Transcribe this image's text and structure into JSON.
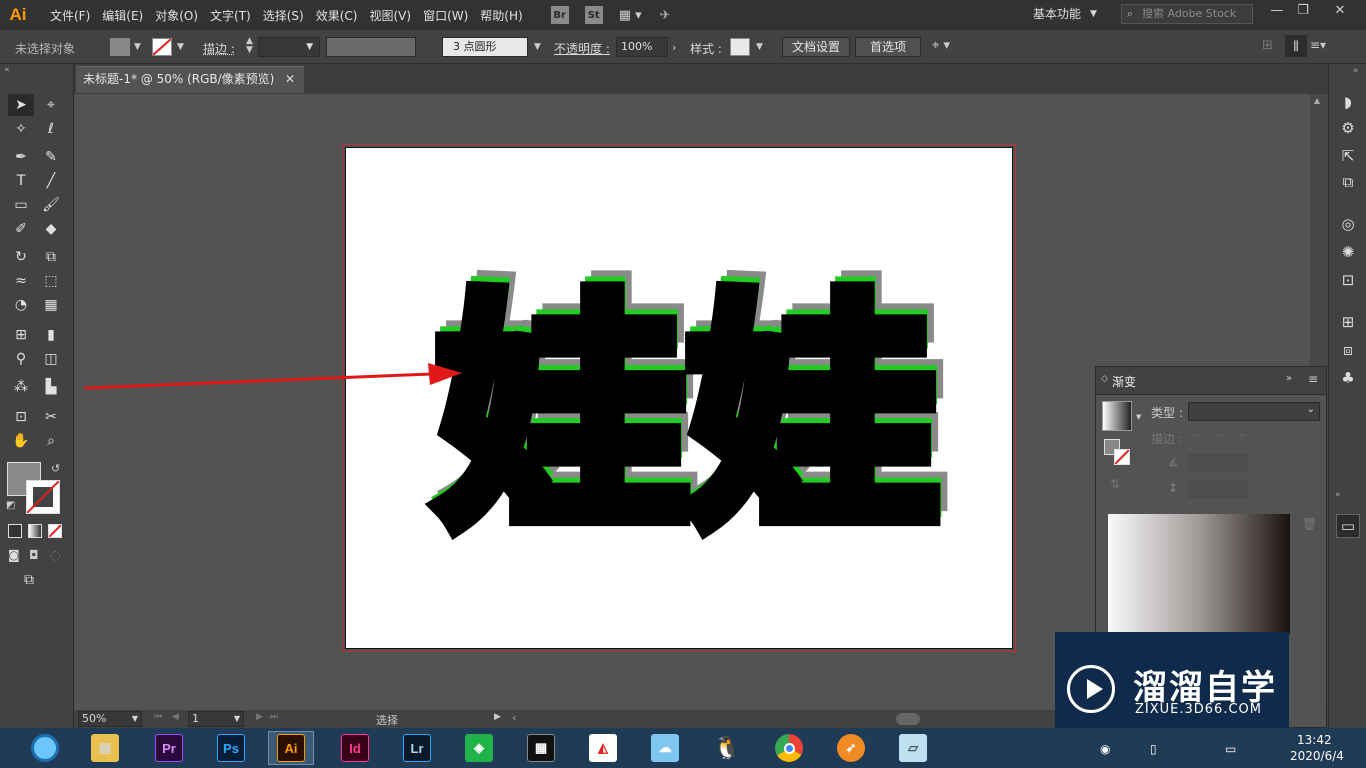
{
  "app": {
    "logo": "Ai"
  },
  "menubar": {
    "items": [
      "文件(F)",
      "编辑(E)",
      "对象(O)",
      "文字(T)",
      "选择(S)",
      "效果(C)",
      "视图(V)",
      "窗口(W)",
      "帮助(H)"
    ],
    "badges": [
      "Br",
      "St"
    ],
    "workspace": "基本功能",
    "search_placeholder": "搜索 Adobe Stock"
  },
  "controlbar": {
    "selection_status": "未选择对象",
    "stroke_label": "描边 :",
    "brush_label": "3 点圆形",
    "opacity_label": "不透明度 :",
    "opacity_value": "100%",
    "style_label": "样式 :",
    "doc_setup_button": "文档设置",
    "preferences_button": "首选项"
  },
  "document": {
    "tab_title": "未标题-1* @ 50% (RGB/像素预览)",
    "artwork_text": "娃娃"
  },
  "statusbar": {
    "zoom": "50%",
    "page": "1",
    "tool": "选择"
  },
  "gradient_panel": {
    "title": "渐变",
    "type_label": "类型 :",
    "stroke_label": "描边 :"
  },
  "taskbar": {
    "apps": [
      "Pr",
      "Ps",
      "Ai",
      "Id",
      "Lr"
    ],
    "time": "13:42",
    "date": "2020/6/4"
  },
  "watermark": {
    "name": "溜溜自学",
    "url": "ZIXUE.3D66.COM"
  },
  "colors": {
    "accent_ai": "#ff9a00",
    "arrow": "#e01818",
    "text_outline": "#22cc22"
  }
}
